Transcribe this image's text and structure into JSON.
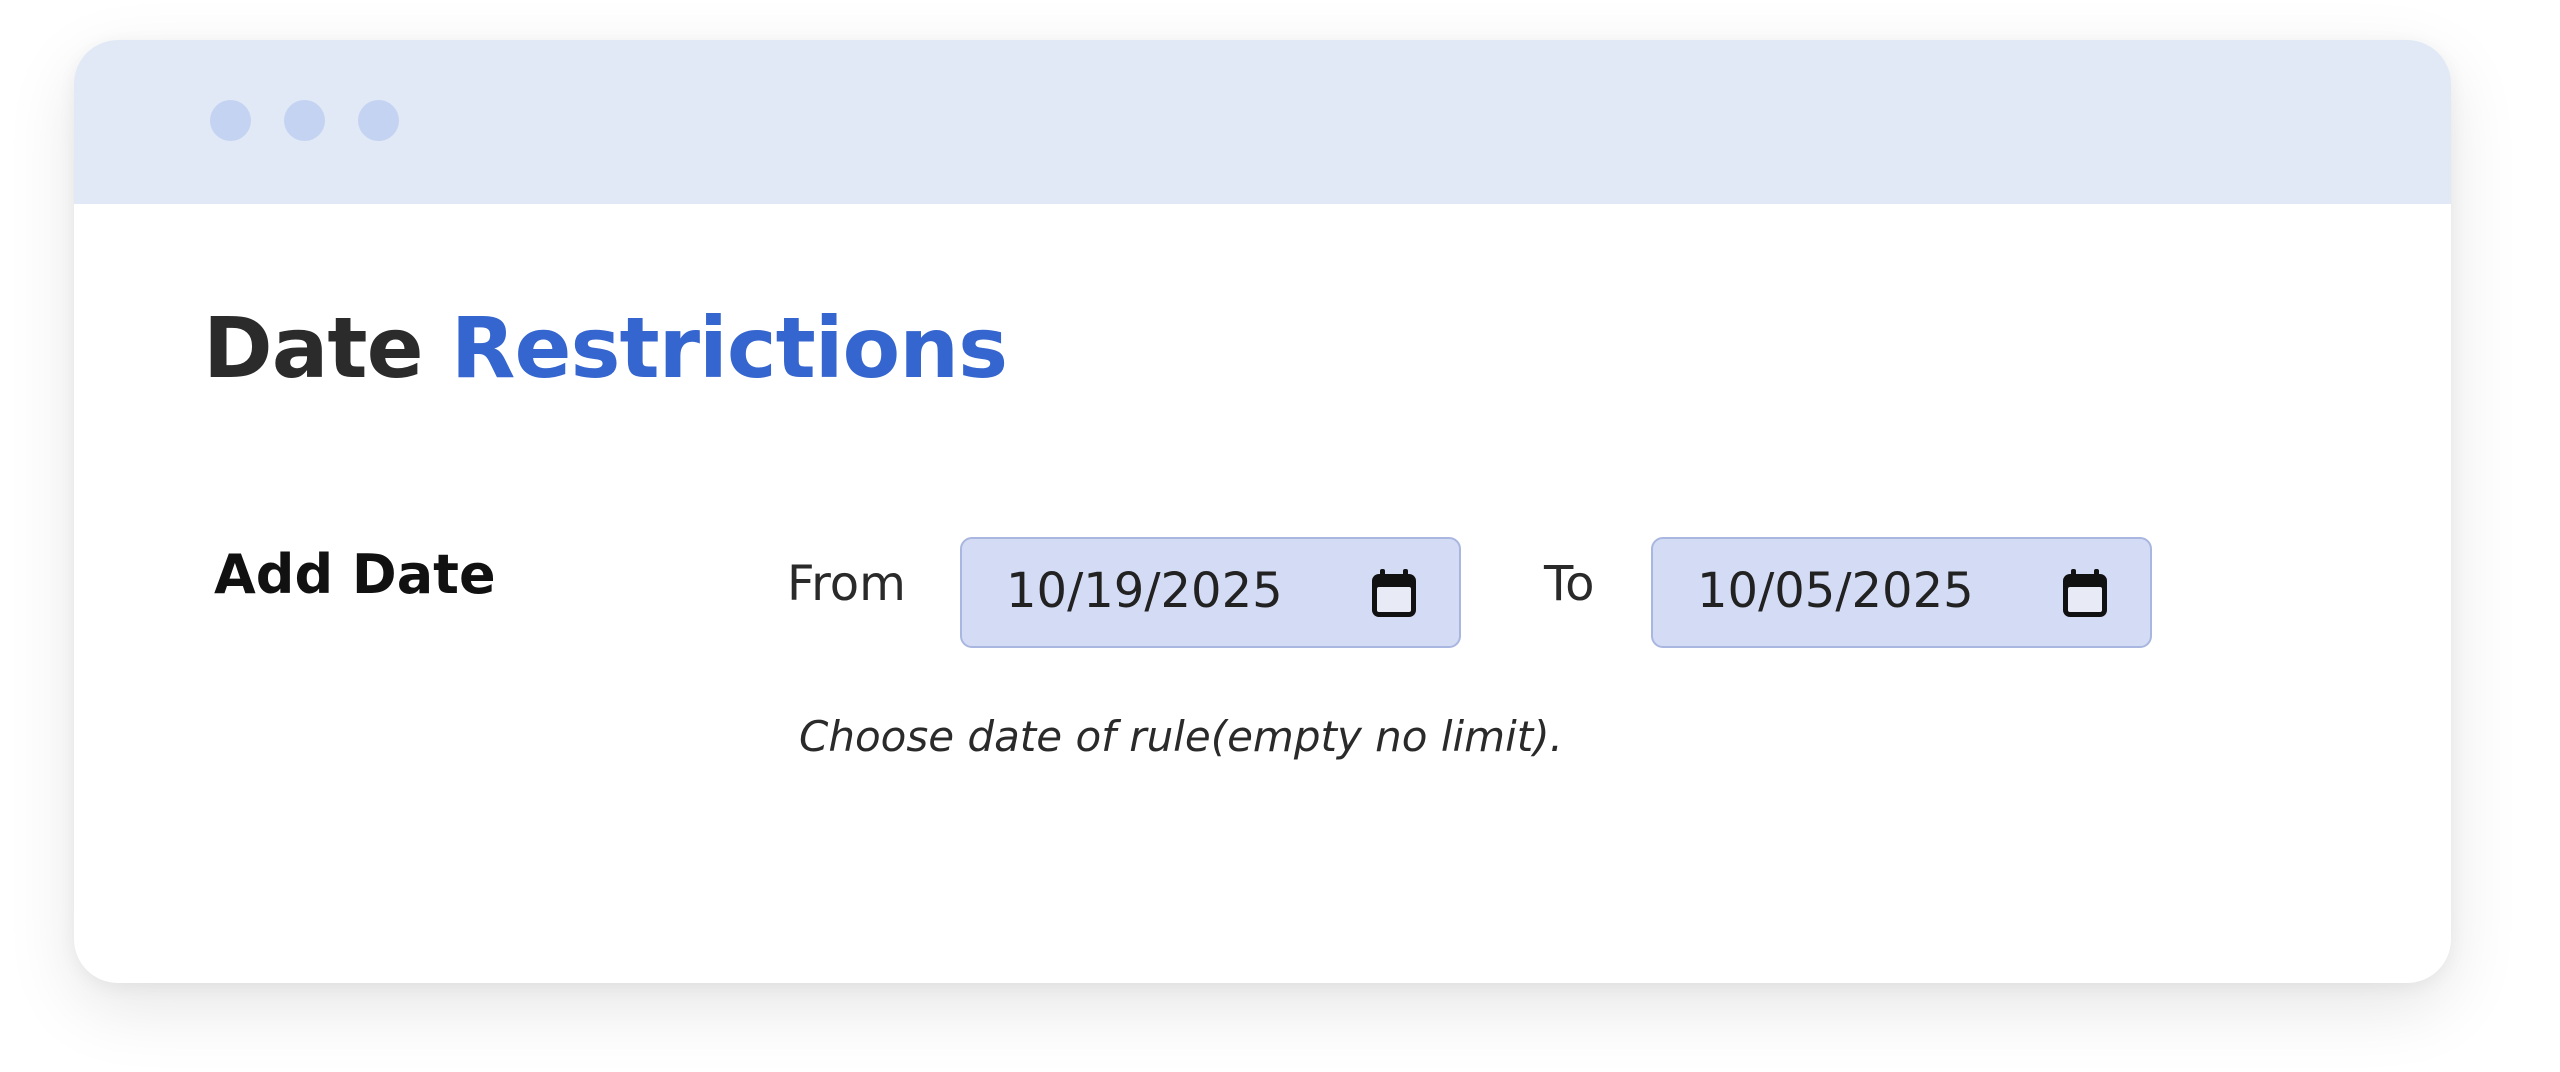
{
  "window": {
    "controls": [
      "dot",
      "dot",
      "dot"
    ]
  },
  "header": {
    "title_part1": "Date",
    "title_part2": "Restrictions"
  },
  "form": {
    "row_label": "Add Date",
    "from_label": "From",
    "from_value": "10/19/2025",
    "to_label": "To",
    "to_value": "10/05/2025",
    "helper_text": "Choose date of rule(empty no limit)."
  },
  "icons": {
    "from_picker": "calendar-icon",
    "to_picker": "calendar-icon"
  },
  "colors": {
    "accent": "#3565cf",
    "titlebar": "#e0e9f5",
    "field_bg": "#d4dcf5"
  }
}
